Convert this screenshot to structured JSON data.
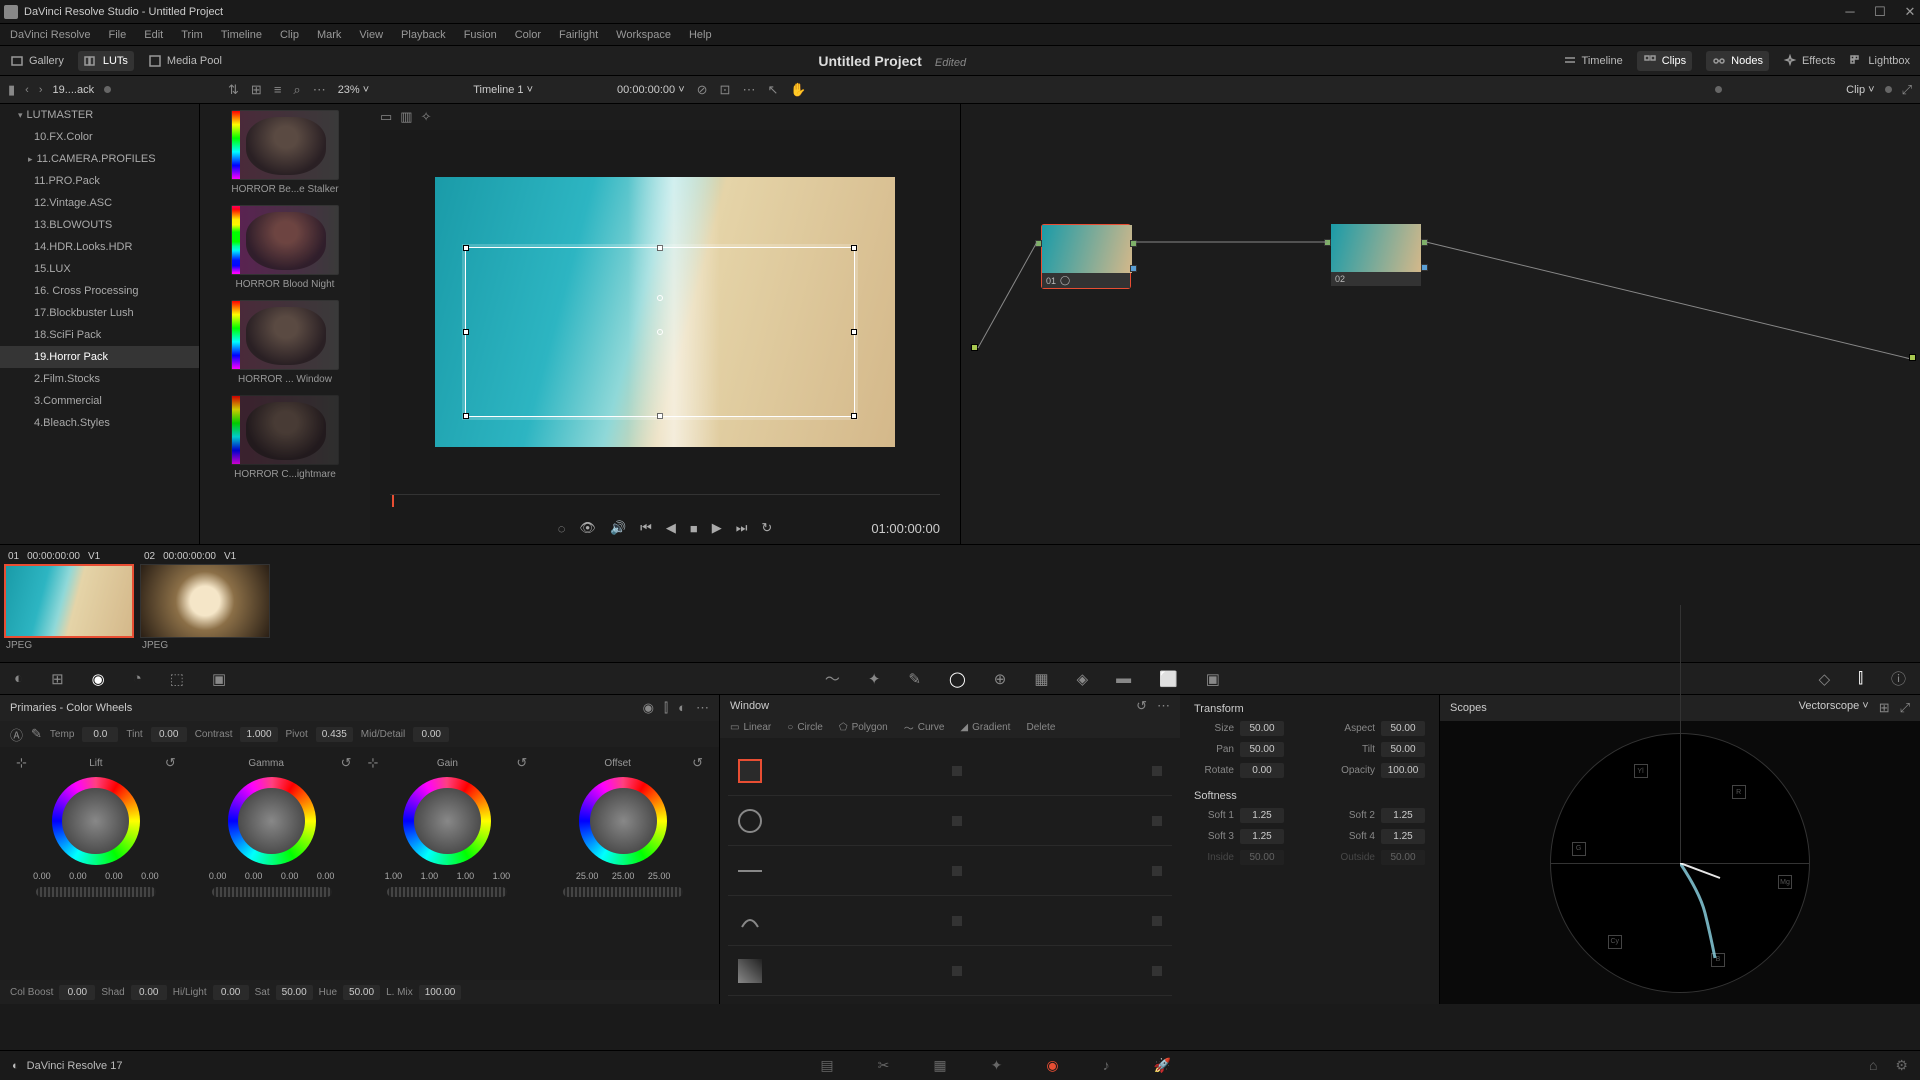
{
  "titlebar": {
    "app_title": "DaVinci Resolve Studio - Untitled Project"
  },
  "menubar": [
    "DaVinci Resolve",
    "File",
    "Edit",
    "Trim",
    "Timeline",
    "Clip",
    "Mark",
    "View",
    "Playback",
    "Fusion",
    "Color",
    "Fairlight",
    "Workspace",
    "Help"
  ],
  "toolbar": {
    "gallery": "Gallery",
    "luts": "LUTs",
    "media": "Media Pool",
    "project": "Untitled Project",
    "edited": "Edited",
    "timeline": "Timeline",
    "clips": "Clips",
    "nodes": "Nodes",
    "effects": "Effects",
    "lightbox": "Lightbox"
  },
  "secbar": {
    "breadcrumb": "19....ack",
    "zoom": "23%",
    "timeline": "Timeline 1",
    "timecode": "00:00:00:00",
    "scope": "Clip"
  },
  "sidebar": [
    {
      "label": "LUTMASTER",
      "parent": true,
      "expanded": true
    },
    {
      "label": "10.FX.Color"
    },
    {
      "label": "11.CAMERA.PROFILES",
      "collapsed": true
    },
    {
      "label": "11.PRO.Pack"
    },
    {
      "label": "12.Vintage.ASC"
    },
    {
      "label": "13.BLOWOUTS"
    },
    {
      "label": "14.HDR.Looks.HDR"
    },
    {
      "label": "15.LUX"
    },
    {
      "label": "16. Cross Processing"
    },
    {
      "label": "17.Blockbuster Lush"
    },
    {
      "label": "18.SciFi Pack"
    },
    {
      "label": "19.Horror Pack",
      "active": true
    },
    {
      "label": "2.Film.Stocks"
    },
    {
      "label": "3.Commercial"
    },
    {
      "label": "4.Bleach.Styles"
    }
  ],
  "luts": [
    {
      "label": "HORROR Be...e Stalker"
    },
    {
      "label": "HORROR Blood Night"
    },
    {
      "label": "HORROR ... Window"
    },
    {
      "label": "HORROR C...ightmare"
    }
  ],
  "viewer": {
    "big_tc": "01:00:00:00"
  },
  "nodes": {
    "n1": "01",
    "n2": "02"
  },
  "clips": [
    {
      "idx": "01",
      "tc": "00:00:00:00",
      "track": "V1",
      "fmt": "JPEG",
      "selected": true,
      "bg": "linear-gradient(105deg,#1a9ba8 0%,#2db5c2 30%,#8fd8d8 45%,#e5d4a8 55%,#d4b88a 100%)"
    },
    {
      "idx": "02",
      "tc": "00:00:00:00",
      "track": "V1",
      "fmt": "JPEG",
      "selected": false,
      "bg": "radial-gradient(circle at 50% 50%, #f5e6c8 20%, #8b6f47 40%, #2a1f15 100%)"
    }
  ],
  "primaries": {
    "title": "Primaries - Color Wheels",
    "temp": {
      "lbl": "Temp",
      "val": "0.0"
    },
    "tint": {
      "lbl": "Tint",
      "val": "0.00"
    },
    "contrast": {
      "lbl": "Contrast",
      "val": "1.000"
    },
    "pivot": {
      "lbl": "Pivot",
      "val": "0.435"
    },
    "middetail": {
      "lbl": "Mid/Detail",
      "val": "0.00"
    },
    "wheels": [
      {
        "name": "Lift",
        "vals": [
          "0.00",
          "0.00",
          "0.00",
          "0.00"
        ]
      },
      {
        "name": "Gamma",
        "vals": [
          "0.00",
          "0.00",
          "0.00",
          "0.00"
        ]
      },
      {
        "name": "Gain",
        "vals": [
          "1.00",
          "1.00",
          "1.00",
          "1.00"
        ]
      },
      {
        "name": "Offset",
        "vals": [
          "25.00",
          "25.00",
          "25.00"
        ]
      }
    ],
    "bottom": {
      "colboost": {
        "lbl": "Col Boost",
        "val": "0.00"
      },
      "shad": {
        "lbl": "Shad",
        "val": "0.00"
      },
      "hilight": {
        "lbl": "Hi/Light",
        "val": "0.00"
      },
      "sat": {
        "lbl": "Sat",
        "val": "50.00"
      },
      "hue": {
        "lbl": "Hue",
        "val": "50.00"
      },
      "lmix": {
        "lbl": "L. Mix",
        "val": "100.00"
      }
    }
  },
  "window": {
    "title": "Window",
    "tools": {
      "linear": "Linear",
      "circle": "Circle",
      "polygon": "Polygon",
      "curve": "Curve",
      "gradient": "Gradient",
      "delete": "Delete"
    },
    "transform": {
      "title": "Transform",
      "size": {
        "lbl": "Size",
        "val": "50.00"
      },
      "aspect": {
        "lbl": "Aspect",
        "val": "50.00"
      },
      "pan": {
        "lbl": "Pan",
        "val": "50.00"
      },
      "tilt": {
        "lbl": "Tilt",
        "val": "50.00"
      },
      "rotate": {
        "lbl": "Rotate",
        "val": "0.00"
      },
      "opacity": {
        "lbl": "Opacity",
        "val": "100.00"
      }
    },
    "softness": {
      "title": "Softness",
      "s1": {
        "lbl": "Soft 1",
        "val": "1.25"
      },
      "s2": {
        "lbl": "Soft 2",
        "val": "1.25"
      },
      "s3": {
        "lbl": "Soft 3",
        "val": "1.25"
      },
      "s4": {
        "lbl": "Soft 4",
        "val": "1.25"
      },
      "inside": {
        "lbl": "Inside",
        "val": "50.00"
      },
      "outside": {
        "lbl": "Outside",
        "val": "50.00"
      }
    }
  },
  "scopes": {
    "title": "Scopes",
    "type": "Vectorscope"
  },
  "bottombar": {
    "version": "DaVinci Resolve 17"
  }
}
